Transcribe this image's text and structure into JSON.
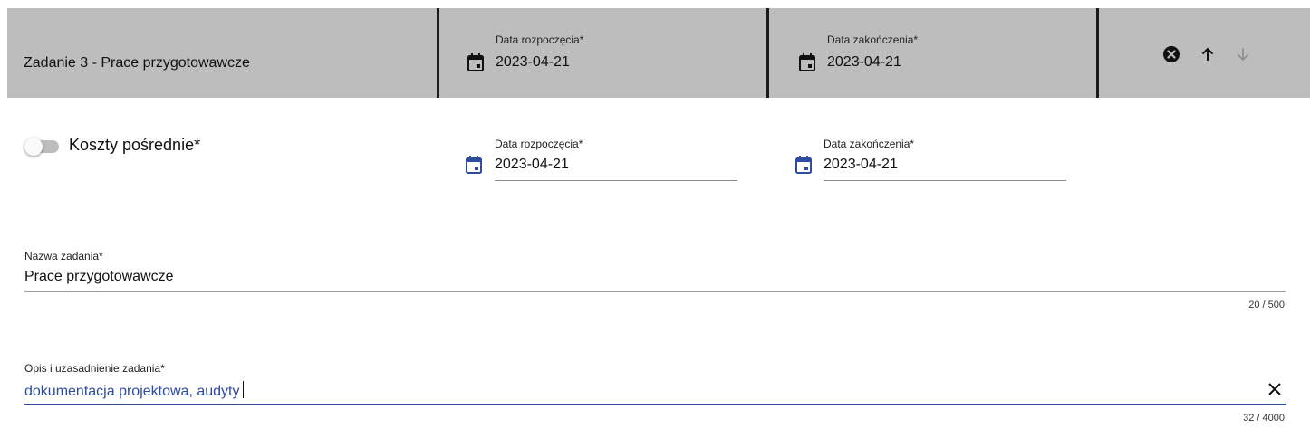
{
  "header": {
    "task_title": "Zadanie 3 - Prace przygotowawcze",
    "start_label": "Data rozpoczęcia*",
    "start_value": "2023-04-21",
    "end_label": "Data zakończenia*",
    "end_value": "2023-04-21",
    "actions": {
      "remove": "remove-circle-icon",
      "move_up": "arrow-up-icon",
      "move_down": "arrow-down-icon"
    }
  },
  "indirect_costs": {
    "label": "Koszty pośrednie*",
    "enabled": false
  },
  "dates": {
    "start_label": "Data rozpoczęcia*",
    "start_value": "2023-04-21",
    "end_label": "Data zakończenia*",
    "end_value": "2023-04-21"
  },
  "task_name": {
    "label": "Nazwa zadania*",
    "value": "Prace przygotowawcze",
    "counter": "20 / 500"
  },
  "description": {
    "label": "Opis i uzasadnienie zadania*",
    "value": "dokumentacja projektowa, audyty",
    "counter": "32 / 4000"
  },
  "colors": {
    "header_bg": "#bdbdbd",
    "accent": "#2e4ba0",
    "calendar_blue": "#2e4ba0"
  }
}
